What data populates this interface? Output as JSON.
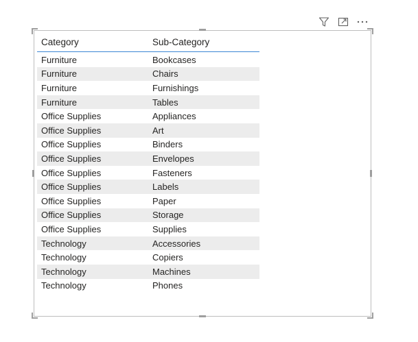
{
  "visual_header": {
    "icons": [
      {
        "name": "filter-icon"
      },
      {
        "name": "focus-mode-icon"
      },
      {
        "name": "more-options-icon"
      }
    ]
  },
  "table": {
    "columns": [
      "Category",
      "Sub-Category"
    ],
    "rows": [
      [
        "Furniture",
        "Bookcases"
      ],
      [
        "Furniture",
        "Chairs"
      ],
      [
        "Furniture",
        "Furnishings"
      ],
      [
        "Furniture",
        "Tables"
      ],
      [
        "Office Supplies",
        "Appliances"
      ],
      [
        "Office Supplies",
        "Art"
      ],
      [
        "Office Supplies",
        "Binders"
      ],
      [
        "Office Supplies",
        "Envelopes"
      ],
      [
        "Office Supplies",
        "Fasteners"
      ],
      [
        "Office Supplies",
        "Labels"
      ],
      [
        "Office Supplies",
        "Paper"
      ],
      [
        "Office Supplies",
        "Storage"
      ],
      [
        "Office Supplies",
        "Supplies"
      ],
      [
        "Technology",
        "Accessories"
      ],
      [
        "Technology",
        "Copiers"
      ],
      [
        "Technology",
        "Machines"
      ],
      [
        "Technology",
        "Phones"
      ]
    ]
  },
  "colors": {
    "header_underline": "#3a86d4",
    "alt_row": "#ececec",
    "text": "#252423",
    "border": "#bdbdbd"
  }
}
